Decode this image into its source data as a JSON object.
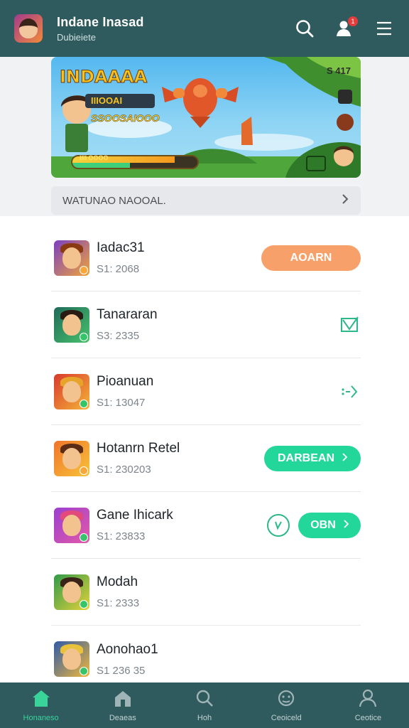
{
  "header": {
    "title": "Indane Inasad",
    "subtitle": "Dubieiete",
    "notification_count": "1"
  },
  "banner": {
    "title": "INDAAAA",
    "tag": "IIIOOAI",
    "subtitle": "SSOOSAIOOO",
    "stats": "S  417",
    "hud_label": "IIII OOOO",
    "hud_primary_fill": 0.82,
    "hud_secondary_fill": 0.46
  },
  "section_row": {
    "label": "WATUNAO NAOOAL."
  },
  "games": [
    {
      "title": "Iadac31",
      "meta": "S1: 2068",
      "action": "button",
      "button_label": "AOARN",
      "button_color": "#f7a06a"
    },
    {
      "title": "Tanararan",
      "meta": "S3: 2335",
      "action": "icon",
      "icon": "check-square-icon"
    },
    {
      "title": "Pioanuan",
      "meta": "S1: 13047",
      "action": "icon",
      "icon": "arrow-dots-icon"
    },
    {
      "title": "Hotanrn Retel",
      "meta": "S1: 230203",
      "action": "button",
      "button_label": "DARBEAN",
      "button_color": "#23d69a"
    },
    {
      "title": "Gane Ihicark",
      "meta": "S1: 23833",
      "action": "circle+button",
      "button_label": "OBN",
      "button_color": "#23d69a",
      "icon": "circle-check-icon"
    },
    {
      "title": "Modah",
      "meta": "S1: 2333",
      "action": "none"
    },
    {
      "title": "Aonohao1",
      "meta": "S1  236 35",
      "action": "none"
    }
  ],
  "bottom_nav": [
    {
      "label": "Honaneso",
      "icon": "home-icon",
      "active": true
    },
    {
      "label": "Deaeas",
      "icon": "store-icon",
      "active": false
    },
    {
      "label": "Hoh",
      "icon": "search-icon",
      "active": false
    },
    {
      "label": "Ceoiceld",
      "icon": "gamepad-face-icon",
      "active": false
    },
    {
      "label": "Ceotice",
      "icon": "profile-icon",
      "active": false
    }
  ],
  "colors": {
    "header_bg": "#2f5a5e",
    "accent_green": "#23d69a",
    "accent_orange": "#f7a06a"
  }
}
